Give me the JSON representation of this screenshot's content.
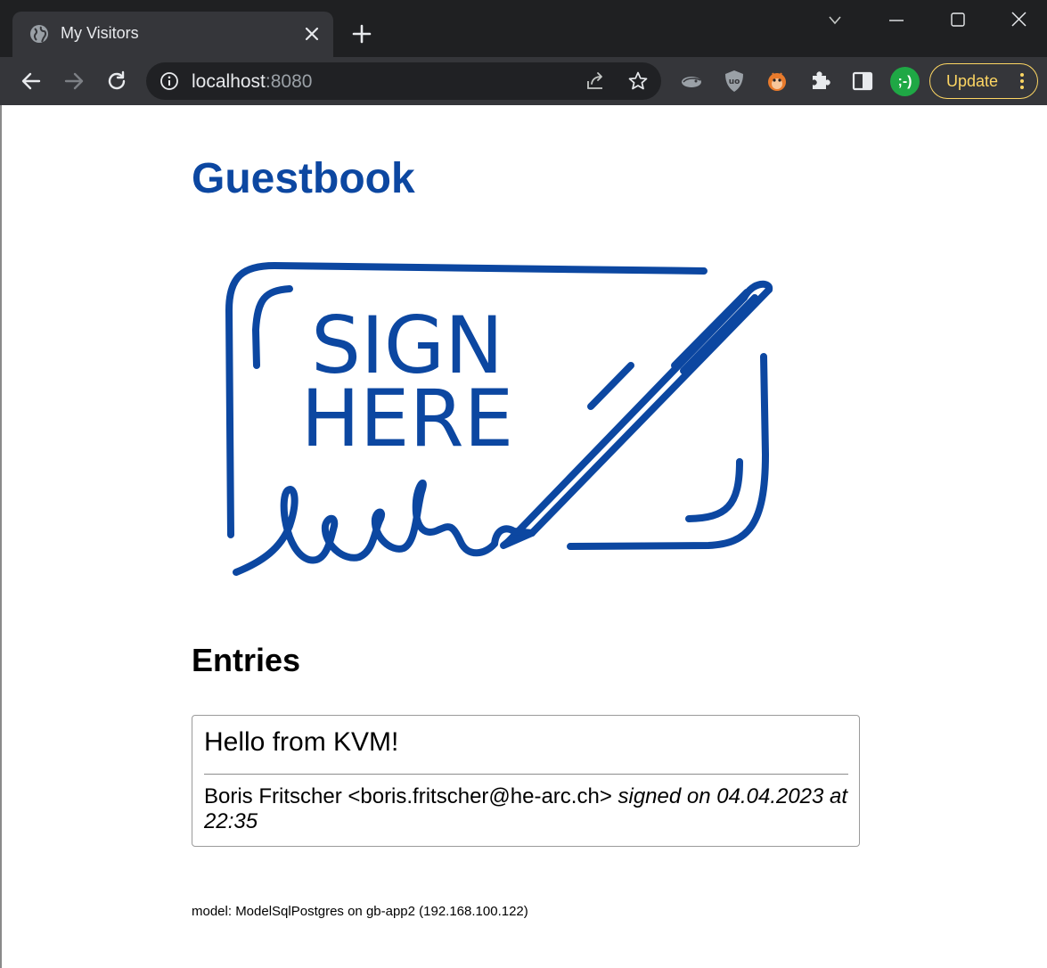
{
  "browser": {
    "tab": {
      "title": "My Visitors",
      "favicon": "globe-icon"
    },
    "address": {
      "host": "localhost",
      "port": ":8080"
    },
    "update_label": "Update",
    "profile_label": ";-)",
    "colors": {
      "chrome": "#35363a",
      "titlebar": "#1f2022",
      "update_accent": "#fdd663",
      "profile": "#1fa845"
    }
  },
  "page": {
    "title": "Guestbook",
    "title_color": "#0c47a1",
    "sign_image": {
      "line1": "SIGN",
      "line2": "HERE"
    },
    "entries_heading": "Entries",
    "entries": [
      {
        "message": "Hello from KVM!",
        "author": "Boris Fritscher <boris.fritscher@he-arc.ch>",
        "signed": "signed on 04.04.2023 at 22:35"
      }
    ],
    "footer": "model: ModelSqlPostgres on gb-app2 (192.168.100.122)"
  }
}
